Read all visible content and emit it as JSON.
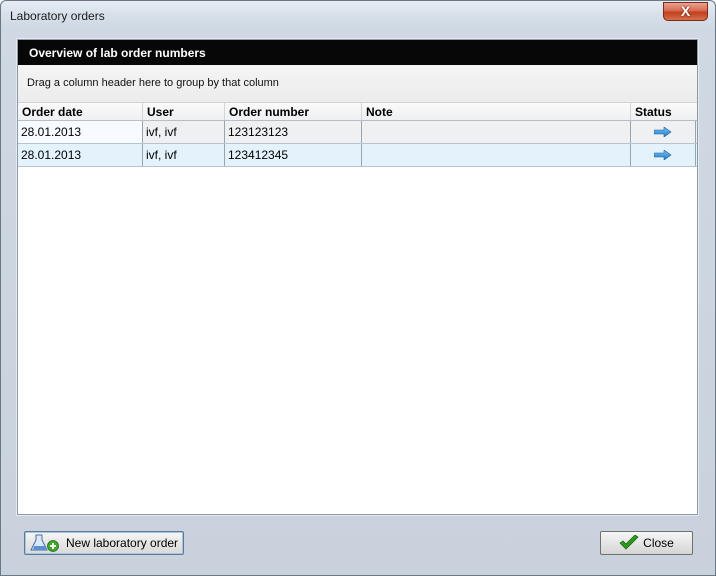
{
  "window": {
    "title": "Laboratory orders",
    "close_glyph": "X"
  },
  "panel": {
    "header": "Overview of lab order numbers",
    "group_hint": "Drag a column header here to group by that column"
  },
  "grid": {
    "columns": [
      "Order date",
      "User",
      "Order number",
      "Note",
      "Status"
    ],
    "rows": [
      {
        "order_date": "28.01.2013",
        "user": "ivf, ivf",
        "order_number": "123123123",
        "note": "",
        "status_icon": "arrow-right-icon"
      },
      {
        "order_date": "28.01.2013",
        "user": "ivf, ivf",
        "order_number": "123412345",
        "note": "",
        "status_icon": "arrow-right-icon"
      }
    ]
  },
  "footer": {
    "new_order_label": "New laboratory order",
    "new_order_icon": "lab-flask-add-icon",
    "close_label": "Close",
    "close_icon": "checkmark-icon"
  },
  "colors": {
    "panel_header_bg": "#070707",
    "row_highlight": "#e3f2fb",
    "arrow_blue": "#2a8fd8",
    "check_green": "#2c9a1e"
  }
}
